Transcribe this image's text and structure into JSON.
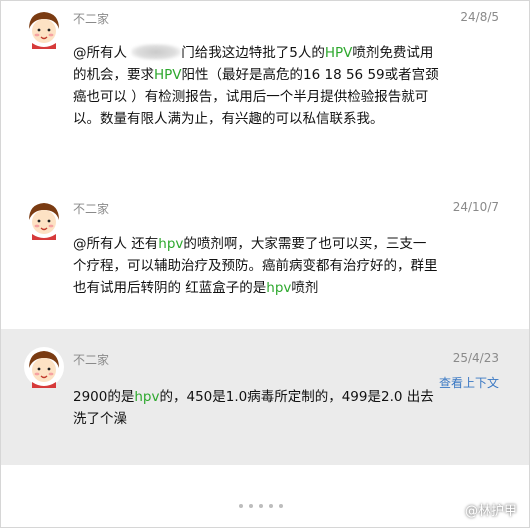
{
  "messages": [
    {
      "sender": "不二家",
      "date": "24/8/5",
      "avatar": "little-peggy-avatar",
      "segments": [
        {
          "t": "@所有人 ",
          "c": ""
        },
        {
          "t": "[blurred]",
          "c": "blur"
        },
        {
          "t": "门给我这边特批了5人的",
          "c": ""
        },
        {
          "t": "HPV",
          "c": "green"
        },
        {
          "t": "喷剂免费试用的机会，要求",
          "c": ""
        },
        {
          "t": "HPV",
          "c": "green"
        },
        {
          "t": "阳性（最好是高危的16 18 56 59或者宫颈癌也可以 ）有检测报告，试用后一个半月提供检验报告就可以。数量有限人满为止，有兴趣的可以私信联系我。",
          "c": ""
        }
      ]
    },
    {
      "sender": "不二家",
      "date": "24/10/7",
      "avatar": "little-peggy-avatar",
      "segments": [
        {
          "t": "@所有人 还有",
          "c": ""
        },
        {
          "t": "hpv",
          "c": "green"
        },
        {
          "t": "的喷剂啊，大家需要了也可以买，三支一个疗程，可以辅助治疗及预防。癌前病变都有治疗好的，群里也有试用后转阴的 红蓝盒子的是",
          "c": ""
        },
        {
          "t": "hpv",
          "c": "green"
        },
        {
          "t": "喷剂",
          "c": ""
        }
      ]
    },
    {
      "sender": "不二家",
      "date": "25/4/23",
      "avatar": "little-peggy-avatar",
      "context_link": "查看上下文",
      "segments": [
        {
          "t": "2900的是",
          "c": ""
        },
        {
          "t": "hpv",
          "c": "green"
        },
        {
          "t": "的，450是1.0病毒所定制的，499是2.0 出去洗了个澡",
          "c": ""
        }
      ]
    }
  ],
  "watermark": "@林护甲",
  "colors": {
    "keyword": "#2ea82e",
    "meta": "#8a8a8a",
    "link": "#3a78c3",
    "highlight_bg": "#ebebeb"
  }
}
